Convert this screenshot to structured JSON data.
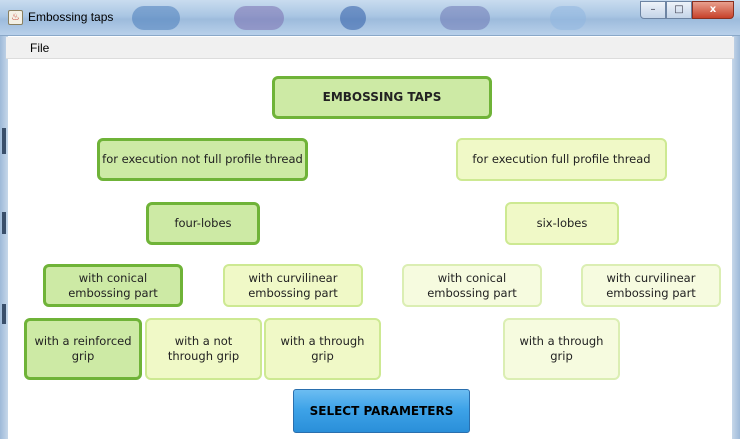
{
  "window": {
    "title": "Embossing taps",
    "controls": {
      "minimize": "–",
      "maximize": "□",
      "close": "x"
    }
  },
  "menu": {
    "file": "File"
  },
  "tree": {
    "root": "EMBOSSING TAPS",
    "level1": {
      "left": "for execution not full profile thread",
      "right": "for execution full profile thread"
    },
    "level2": {
      "left": "four-lobes",
      "right": "six-lobes"
    },
    "level3": {
      "a": "with conical\nembossing part",
      "b": "with curvilinear\nembossing part",
      "c": "with conical\nembossing part",
      "d": "with curvilinear\nembossing part"
    },
    "level4": {
      "a": "with a reinforced\ngrip",
      "b": "with a not\nthrough grip",
      "c": "with a through\ngrip",
      "d": "with a through\ngrip"
    }
  },
  "select_button": "SELECT PARAMETERS",
  "colors": {
    "active_fill": "#cdeaa5",
    "active_border": "#6fb338",
    "available_fill": "#f0f9c7",
    "inactive_fill": "#f6fbdf",
    "button_blue": "#3ea3e8"
  }
}
